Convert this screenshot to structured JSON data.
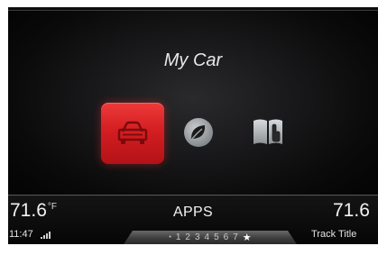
{
  "screen": {
    "title": "My Car"
  },
  "apps": [
    {
      "name": "My Car",
      "icon": "car-icon",
      "selected": true,
      "color": "#d41e22"
    },
    {
      "name": "eco",
      "icon": "leaf-icon",
      "selected": false
    },
    {
      "name": "manual",
      "icon": "book-icon",
      "selected": false
    }
  ],
  "status_bar": {
    "left_temp": "71.6",
    "left_temp_unit": "°F",
    "right_temp": "71.6",
    "center_label": "APPS",
    "clock": "11:47",
    "signal_icon": "signal-bars-icon",
    "track_title": "Track Title",
    "pages": {
      "marker": "•",
      "numbers": [
        "1",
        "2",
        "3",
        "4",
        "5",
        "6",
        "7"
      ],
      "favorites": "★"
    }
  },
  "colors": {
    "accent_red": "#d41e22",
    "background": "#000000",
    "text": "#f2f2f2"
  }
}
